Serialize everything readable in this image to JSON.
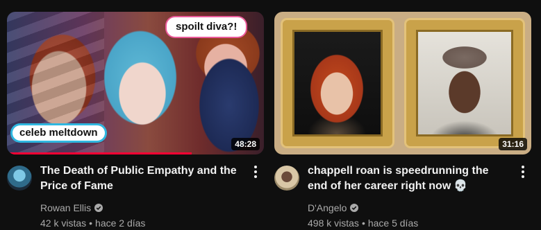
{
  "videos": [
    {
      "title": "The Death of Public Empathy and the Price of Fame",
      "channel": "Rowan Ellis",
      "views": "42 k vistas",
      "age": "hace 2 días",
      "duration": "48:28",
      "thumb_text_top": "spoilt diva?!",
      "thumb_text_bottom": "celeb meltdown",
      "watch_progress": 0.72
    },
    {
      "title": "chappell roan is speedrunning the end of her career right now",
      "title_emoji": "💀",
      "channel": "D'Angelo",
      "views": "498 k vistas",
      "age": "hace 5 días",
      "duration": "31:16"
    }
  ],
  "icons": {
    "menu": "more-vert-icon",
    "verified": "verified-check-icon"
  },
  "colors": {
    "background": "#0f0f0f",
    "title": "#f1f1f1",
    "secondary_text": "#aaaaaa",
    "progress": "#ff0033"
  }
}
